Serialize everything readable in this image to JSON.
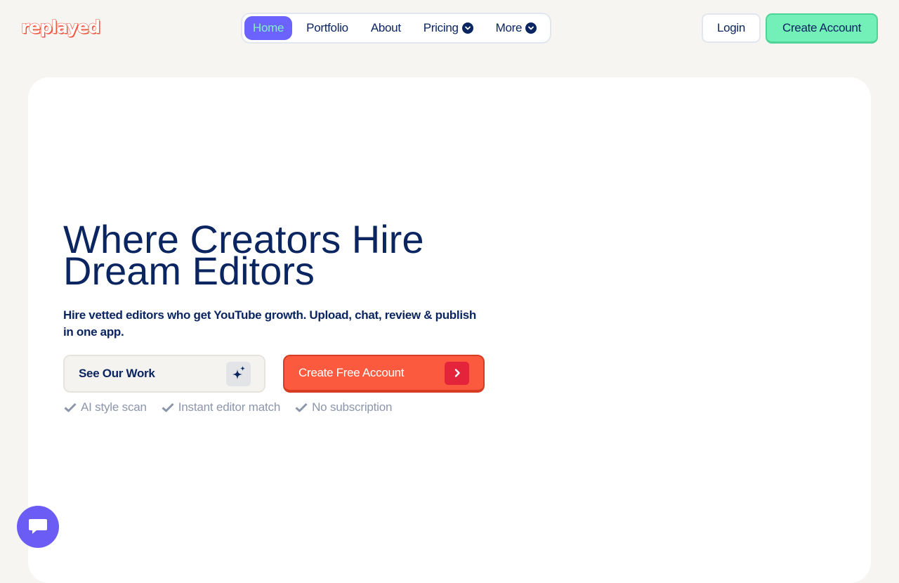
{
  "brand": {
    "logo_text": "replayed",
    "accent": "#f0543c"
  },
  "nav": {
    "items": [
      {
        "label": "Home",
        "active": true
      },
      {
        "label": "Portfolio"
      },
      {
        "label": "About"
      },
      {
        "label": "Pricing",
        "icon": "chevron-down-circle-icon"
      },
      {
        "label": "More",
        "icon": "chevron-down-circle-icon"
      }
    ]
  },
  "header": {
    "login_label": "Login",
    "create_account_label": "Create Account"
  },
  "hero": {
    "title_line1": "Where Creators Hire",
    "title_line2": "Dream Editors",
    "subtitle": "Hire vetted editors who get YouTube growth. Upload, chat, review & publish in one app.",
    "secondary_cta": {
      "label": "See Our Work",
      "icon": "sparkle-icon"
    },
    "primary_cta": {
      "label": "Create Free Account",
      "icon": "chevron-right-icon"
    },
    "features": [
      "AI style scan",
      "Instant editor match",
      "No subscription"
    ]
  },
  "chat_widget": {
    "icon": "chat-icon"
  },
  "colors": {
    "navy": "#0b2560",
    "purple": "#6c63ff",
    "mint": "#72f0b8",
    "coral": "#fb5a3f",
    "muted": "#8c96ab"
  }
}
